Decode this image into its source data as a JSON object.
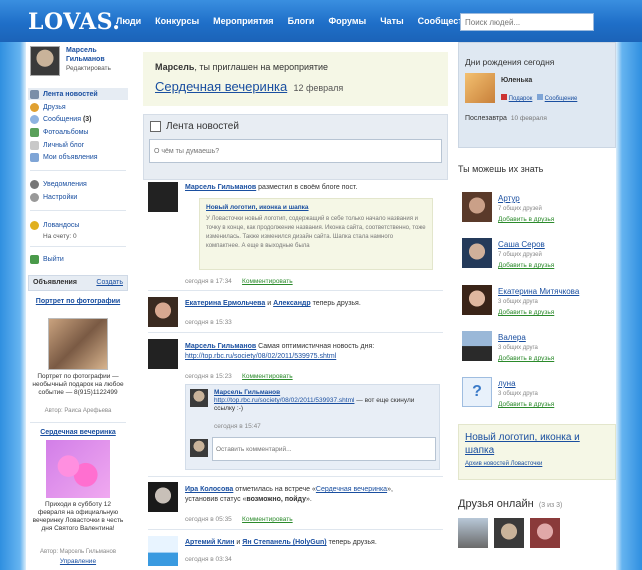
{
  "header": {
    "logo": "LOVAS.",
    "nav": [
      "Люди",
      "Конкурсы",
      "Мероприятия",
      "Блоги",
      "Форумы",
      "Чаты",
      "Сообщества"
    ],
    "search_placeholder": "Поиск людей..."
  },
  "sidebar": {
    "user_name": "Марсель Гильманов",
    "edit_link": "Редактировать",
    "menu": [
      {
        "label": "Лента новостей",
        "icon": "feed-icon",
        "active": true
      },
      {
        "label": "Друзья",
        "icon": "friends-icon"
      },
      {
        "label": "Сообщения",
        "count": "(3)",
        "icon": "messages-icon"
      },
      {
        "label": "Фотоальбомы",
        "icon": "photo-icon"
      },
      {
        "label": "Личный блог",
        "icon": "blog-icon"
      },
      {
        "label": "Мои объявления",
        "icon": "ads-icon"
      }
    ],
    "menu2": [
      {
        "label": "Уведомления",
        "icon": "bell-icon"
      },
      {
        "label": "Настройки",
        "icon": "gear-icon"
      }
    ],
    "lovadosy": {
      "label": "Ловандосы",
      "balance": "На счету: 0"
    },
    "logout": "Выйти",
    "ads": {
      "title": "Объявления",
      "create": "Создать",
      "items": [
        {
          "title": "Портрет по фотографии",
          "text": "Портрет по фотографии — необычный подарок на любое событие — 8(915)1122499",
          "author": "Автор: Раиса Арефьева"
        },
        {
          "title": "Сердечная вечеринка",
          "text": "Приходи в субботу 12 февраля на официальную вечеринку Ловасточки в честь дня Святого Валентина!",
          "author": "Автор: Марсель Гильманов",
          "manage": "Управление"
        }
      ]
    }
  },
  "invite": {
    "name": "Марсель",
    "text": ", ты приглашен на мероприятие",
    "event": "Сердечная вечеринка",
    "date": "12 февраля"
  },
  "feed": {
    "title": "Лента новостей",
    "status_placeholder": "О чём ты думаешь?",
    "items": [
      {
        "author": "Марсель Гильманов",
        "action": "разместил в своём блоге пост.",
        "post_title": "Новый логотип, иконка и шапка",
        "post_text": "У Ловасточки новый логотип, содержащий в себе только начало названия и точку в конце, как продолжение названия. Иконка сайта, соответственно, тоже изменилась. Также изменился дизайн сайта. Шапка стала намного компактнее. А еще в выходные была",
        "time": "сегодня в 17:34",
        "comment": "Комментировать"
      },
      {
        "author": "Екатерина Ермольчева",
        "and": "и",
        "author2": "Александр",
        "action": "теперь друзья.",
        "time": "сегодня в 15:33"
      },
      {
        "author": "Марсель Гильманов",
        "action": "Самая оптимистичная новость дня:",
        "url": "http://top.rbc.ru/society/08/02/2011/539975.shtml",
        "time": "сегодня в 15:23",
        "comment": "Комментировать",
        "reply": {
          "author": "Марсель Гильманов",
          "url": "http://top.rbc.ru/society/08/02/2011/539937.shtml",
          "text": "— вот еще скинули ссылку :-)",
          "time": "сегодня в 15:47"
        },
        "comment_placeholder": "Оставить комментарий..."
      },
      {
        "author": "Ира Колосова",
        "action": "отметилась на встрече «",
        "event": "Сердечная вечеринка",
        "action2": "»,",
        "status_prefix": "установив статус «",
        "status": "возможно, пойду",
        "status_suffix": "».",
        "time": "сегодня в 05:35",
        "comment": "Комментировать"
      },
      {
        "author": "Артемий Клин",
        "and": "и",
        "author2": "Ян Степанель (HolyGun)",
        "action": "теперь друзья.",
        "time": "сегодня в 03:34"
      }
    ]
  },
  "birthdays": {
    "title": "Дни рождения сегодня",
    "person": "Юленька",
    "gift": "Подарок",
    "message": "Сообщение",
    "after_label": "Послезавтра",
    "after_date": "10 февраля"
  },
  "suggest": {
    "title": "Ты можешь их знать",
    "add": "Добавить в друзья",
    "people": [
      {
        "name": "Артур",
        "common": "7 общих друзей"
      },
      {
        "name": "Саша Серов",
        "common": "7 общих друзей"
      },
      {
        "name": "Екатерина Митячкова",
        "common": "3 общих друга"
      },
      {
        "name": "Валера",
        "common": "3 общих друга"
      },
      {
        "name": "луна",
        "common": "3 общих друга"
      }
    ]
  },
  "blog_widget": {
    "title": "Новый логотип, иконка и шапка",
    "archive": "Архив новостей Ловасточки"
  },
  "online": {
    "title": "Друзья онлайн",
    "count": "(3 из 3)"
  },
  "colors": {
    "header_blue": "#1f6fc8",
    "link_blue": "#1a4fa0",
    "green_link": "#2b8a2b",
    "pale_yellow": "#f5f7e6"
  }
}
